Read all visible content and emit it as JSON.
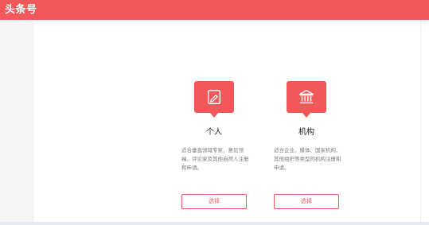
{
  "header": {
    "logo_text": "头条号",
    "accent_color": "#f0585a"
  },
  "cards": [
    {
      "icon": "pencil-icon",
      "title": "个人",
      "description": "适合垂直领域专家、意见领袖、评论家及其他自然人注册和申请。",
      "button_label": "选择"
    },
    {
      "icon": "institution-icon",
      "title": "机构",
      "description": "适合企业、媒体、国家机构、其他组织等类型的机构注册和申请。",
      "button_label": "选择"
    }
  ]
}
